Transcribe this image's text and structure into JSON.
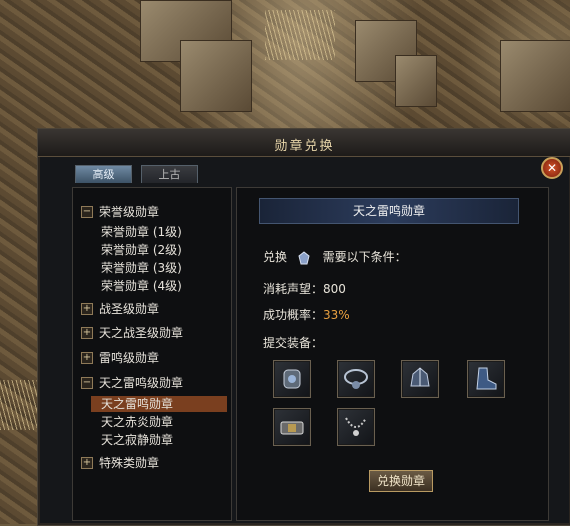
{
  "window": {
    "title": "勋章兑换"
  },
  "tabs": [
    {
      "label": "高级",
      "active": true
    },
    {
      "label": "上古",
      "active": false
    }
  ],
  "tree": {
    "groups": [
      {
        "label": "荣誉级勋章",
        "expanded": true,
        "toggle": "−",
        "children": [
          "荣誉勋章 (1级)",
          "荣誉勋章 (2级)",
          "荣誉勋章 (3级)",
          "荣誉勋章 (4级)"
        ]
      },
      {
        "label": "战圣级勋章",
        "expanded": false,
        "toggle": "+"
      },
      {
        "label": "天之战圣级勋章",
        "expanded": false,
        "toggle": "+"
      },
      {
        "label": "雷鸣级勋章",
        "expanded": false,
        "toggle": "+"
      },
      {
        "label": "天之雷鸣级勋章",
        "expanded": true,
        "toggle": "−",
        "children": [
          "天之雷鸣勋章",
          "天之赤炎勋章",
          "天之寂静勋章"
        ],
        "selected": "天之雷鸣勋章"
      },
      {
        "label": "特殊类勋章",
        "expanded": false,
        "toggle": "+"
      }
    ]
  },
  "detail": {
    "title": "天之雷鸣勋章",
    "exchange_label": "兑换",
    "requirement_label": "需要以下条件：",
    "cost_label": "消耗声望：",
    "cost_value": "800",
    "rate_label": "成功概率：",
    "rate_value": "33%",
    "submit_label": "提交装备：",
    "equipment": [
      "bracer-icon",
      "necklace-icon",
      "helmet-icon",
      "boots-icon",
      "belt-icon",
      "chain-necklace-icon"
    ],
    "confirm_button": "兑换勋章"
  },
  "colors": {
    "selected_row": "#7a3f1f",
    "rate_value": "#e8a040",
    "banner": "#2c3c5c"
  }
}
